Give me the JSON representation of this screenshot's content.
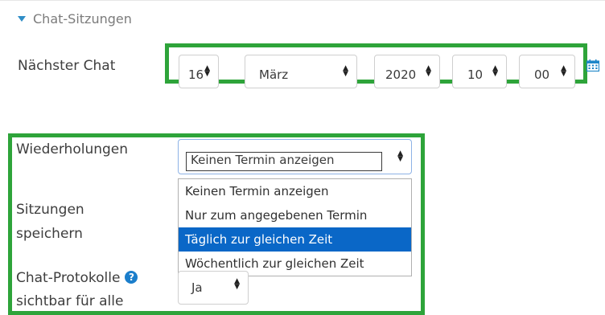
{
  "section": {
    "title": "Chat-Sitzungen",
    "icon": "triangle-down-icon"
  },
  "next_chat": {
    "label": "Nächster Chat",
    "day": "16",
    "month": "März",
    "year": "2020",
    "hour": "10",
    "minute": "00",
    "calendar_icon": "calendar-icon"
  },
  "repeat": {
    "label": "Wiederholungen",
    "selected": "Keinen Termin anzeigen",
    "options": [
      "Keinen Termin anzeigen",
      "Nur zum angegebenen Termin",
      "Täglich zur gleichen Zeit",
      "Wöchentlich zur gleichen Zeit"
    ],
    "highlighted_index": 2
  },
  "save_sessions": {
    "label_line1": "Sitzungen",
    "label_line2": "speichern"
  },
  "protocols": {
    "label_line1": "Chat-Protokolle",
    "label_line2": "sichtbar für alle",
    "help_icon": "question-circle-icon",
    "value": "Ja"
  },
  "colors": {
    "highlight_box": "#2ea43a",
    "selected_option": "#0a67c7",
    "accent": "#2f8ec7"
  }
}
